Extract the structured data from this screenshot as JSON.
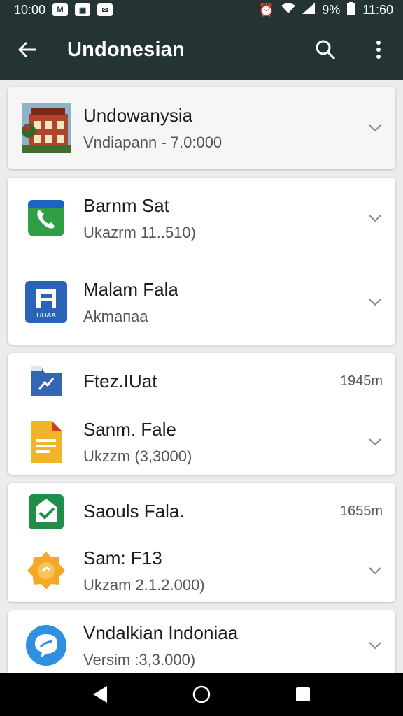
{
  "status_bar": {
    "time_left": "10:00",
    "battery": "9%",
    "time_right": "11:60"
  },
  "app_bar": {
    "title": "Undonesian",
    "back_icon": "back-arrow-icon",
    "search_icon": "search-icon",
    "more_icon": "more-vert-icon"
  },
  "cards": [
    {
      "rows": [
        {
          "name": "Undowanysia",
          "sub": "Vndiapann - 7.0:000",
          "icon": "building-photo-icon",
          "trailing": ""
        }
      ]
    },
    {
      "rows": [
        {
          "name": "Barnm Sat",
          "sub": "Ukazrm 11..510)",
          "icon": "phone-icon",
          "trailing": ""
        },
        {
          "name": "Malam Fala",
          "sub": "Akmaпaa",
          "icon": "book-icon",
          "trailing": ""
        }
      ]
    },
    {
      "rows": [
        {
          "name": "Ftez.IUat",
          "sub": "",
          "icon": "folder-chart-icon",
          "trailing": "1945m"
        },
        {
          "name": "Sanm. Fale",
          "sub": "Ukzzm (3,3000)",
          "icon": "document-icon",
          "trailing": ""
        }
      ]
    },
    {
      "rows": [
        {
          "name": "Saouls Fala.",
          "sub": "",
          "icon": "green-check-icon",
          "trailing": "1655m"
        },
        {
          "name": "Sam: F13",
          "sub": "Ukzam 2.1.2.000)",
          "icon": "badge-icon",
          "trailing": ""
        }
      ]
    },
    {
      "rows": [
        {
          "name": "Vndalkian Indoniaa",
          "sub": "Versim :3,3.000)",
          "icon": "chat-bubble-icon",
          "trailing": ""
        }
      ]
    }
  ],
  "nav": {
    "back": "nav-back-icon",
    "home": "nav-home-icon",
    "recents": "nav-recents-icon"
  }
}
